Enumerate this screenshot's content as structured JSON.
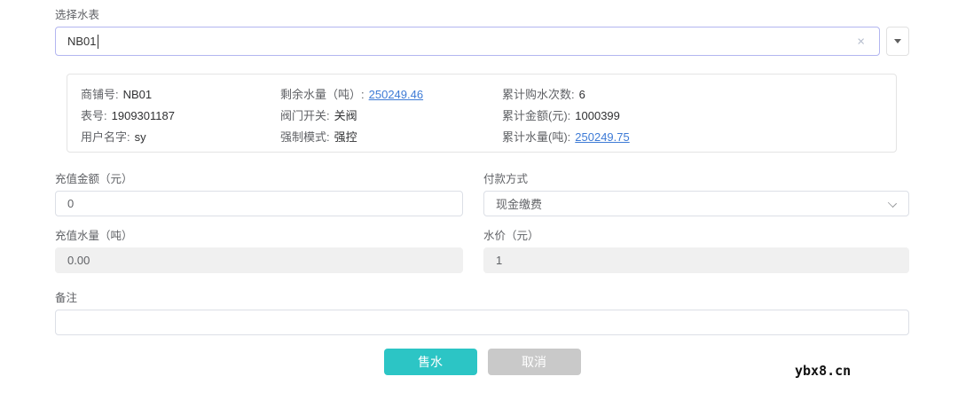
{
  "meter_select": {
    "label": "选择水表",
    "value": "NB01",
    "icons": {
      "clear": "×",
      "dropdown": "caret-down"
    }
  },
  "meter_info": {
    "fields": [
      {
        "label": "商铺号:",
        "value": "NB01",
        "link": false
      },
      {
        "label": "剩余水量（吨）:",
        "value": "250249.46",
        "link": true
      },
      {
        "label": "累计购水次数:",
        "value": "6",
        "link": false
      },
      {
        "label": "表号:",
        "value": "1909301187",
        "link": false
      },
      {
        "label": "阀门开关:",
        "value": "关阀",
        "link": false
      },
      {
        "label": "累计金额(元):",
        "value": "1000399",
        "link": false
      },
      {
        "label": "用户名字:",
        "value": "sy",
        "link": false
      },
      {
        "label": "强制模式:",
        "value": "强控",
        "link": false
      },
      {
        "label": "累计水量(吨):",
        "value": "250249.75",
        "link": true
      }
    ]
  },
  "form": {
    "recharge_amount": {
      "label": "充值金额（元）",
      "value": "0"
    },
    "payment_method": {
      "label": "付款方式",
      "value": "现金缴费"
    },
    "recharge_volume": {
      "label": "充值水量（吨）",
      "value": "0.00"
    },
    "water_price": {
      "label": "水价（元）",
      "value": "1"
    },
    "remark": {
      "label": "备注",
      "value": ""
    }
  },
  "actions": {
    "sell_label": "售水",
    "cancel_label": "取消"
  },
  "page": {
    "watermark": "ybx8.cn"
  },
  "colors": {
    "accent_teal": "#2cc5c5",
    "cancel_gray": "#c9c9c9",
    "link_blue": "#3e7bd6",
    "focus_border": "#b3b6f0",
    "disabled_bg": "#f0f0f0"
  }
}
